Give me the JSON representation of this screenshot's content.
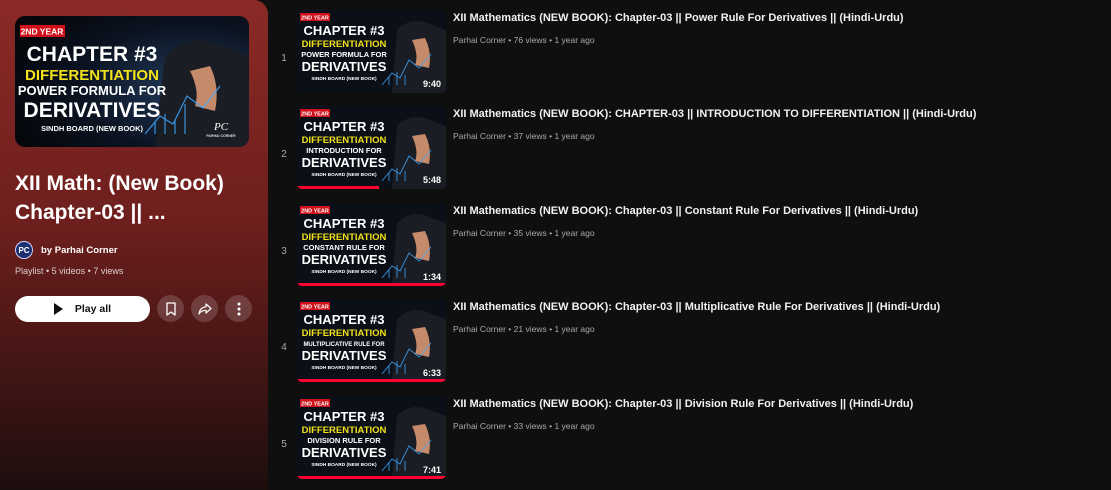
{
  "playlist": {
    "title": "XII Math: (New Book) Chapter-03 || ...",
    "owner_prefix": "by",
    "owner_name": "Parhai Corner",
    "owner_avatar_text": "PC",
    "meta": "Playlist • 5 videos • 7 views",
    "play_all_label": "Play all",
    "cover": {
      "badge": "2ND YEAR",
      "line1": "CHAPTER #3",
      "line2": "DIFFERENTIATION",
      "line3": "POWER FORMULA FOR",
      "line4": "DERIVATIVES",
      "footer": "SINDH BOARD (NEW BOOK)",
      "brand": "PC",
      "brand_sub": "PARHAI CORNER"
    },
    "icons": {
      "save": "bookmark-icon",
      "share": "share-icon",
      "more": "more-vert-icon"
    }
  },
  "videos": [
    {
      "index": "1",
      "title": "XII Mathematics (NEW BOOK): Chapter-03 || Power Rule For Derivatives || (Hindi-Urdu)",
      "channel": "Parhai Corner",
      "views": "76 views",
      "age": "1 year ago",
      "duration": "9:40",
      "progress": 0,
      "thumb": {
        "badge": "2ND YEAR",
        "line1": "CHAPTER #3",
        "line2": "DIFFERENTIATION",
        "line3": "POWER FORMULA FOR",
        "line4": "DERIVATIVES",
        "footer": "SINDH BOARD (NEW BOOK)"
      }
    },
    {
      "index": "2",
      "title": "XII Mathematics (NEW BOOK): CHAPTER-03 || INTRODUCTION TO DIFFERENTIATION || (Hindi-Urdu)",
      "channel": "Parhai Corner",
      "views": "37 views",
      "age": "1 year ago",
      "duration": "5:48",
      "progress": 0.55,
      "thumb": {
        "badge": "2ND YEAR",
        "line1": "CHAPTER #3",
        "line2": "DIFFERENTIATION",
        "line3": "INTRODUCTION FOR",
        "line4": "DERIVATIVES",
        "footer": "SINDH BOARD (NEW BOOK)"
      }
    },
    {
      "index": "3",
      "title": "XII Mathematics (NEW BOOK): Chapter-03 || Constant Rule For Derivatives || (Hindi-Urdu)",
      "channel": "Parhai Corner",
      "views": "35 views",
      "age": "1 year ago",
      "duration": "1:34",
      "progress": 1,
      "thumb": {
        "badge": "2ND YEAR",
        "line1": "CHAPTER #3",
        "line2": "DIFFERENTIATION",
        "line3": "CONSTANT RULE FOR",
        "line4": "DERIVATIVES",
        "footer": "SINDH BOARD (NEW BOOK)"
      }
    },
    {
      "index": "4",
      "title": "XII Mathematics (NEW BOOK): Chapter-03 || Multiplicative Rule For Derivatives || (Hindi-Urdu)",
      "channel": "Parhai Corner",
      "views": "21 views",
      "age": "1 year ago",
      "duration": "6:33",
      "progress": 1,
      "thumb": {
        "badge": "2ND YEAR",
        "line1": "CHAPTER #3",
        "line2": "DIFFERENTIATION",
        "line3": "MULTIPLICATIVE RULE FOR",
        "line4": "DERIVATIVES",
        "footer": "SINDH BOARD (NEW BOOK)"
      }
    },
    {
      "index": "5",
      "title": "XII Mathematics (NEW BOOK): Chapter-03 || Division Rule For Derivatives || (Hindi-Urdu)",
      "channel": "Parhai Corner",
      "views": "33 views",
      "age": "1 year ago",
      "duration": "7:41",
      "progress": 1,
      "thumb": {
        "badge": "2ND YEAR",
        "line1": "CHAPTER #3",
        "line2": "DIFFERENTIATION",
        "line3": "DIVISION RULE FOR",
        "line4": "DERIVATIVES",
        "footer": "SINDH BOARD (NEW BOOK)"
      }
    }
  ],
  "colors": {
    "accent_red": "#ff0033",
    "panel_top": "#8a2a26",
    "page_bg": "#0f0f0f",
    "thumb_yellow": "#f3e21a",
    "thumb_badge": "#d0101a"
  }
}
